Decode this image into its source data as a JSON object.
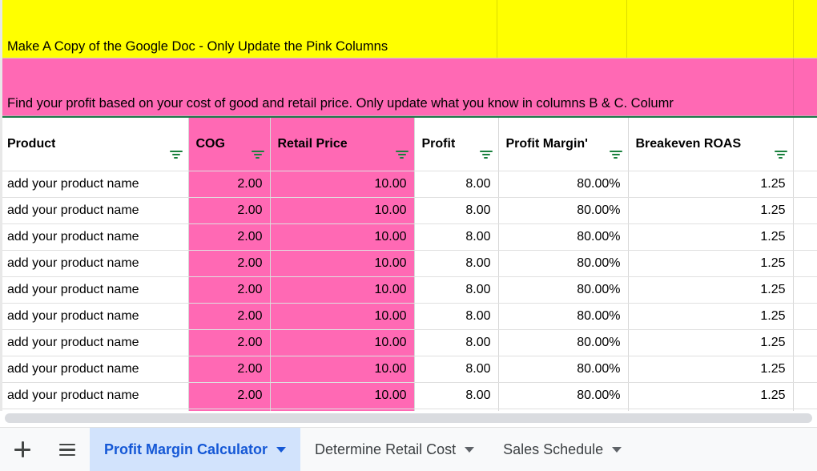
{
  "banners": {
    "yellow": {
      "text": "Make A Copy of the Google Doc - Only Update the Pink Columns",
      "bg": "#ffff00"
    },
    "pink": {
      "text": "Find your profit based on your cost of good and retail price. Only update what you know in columns B & C. Columr",
      "bg": "#ff69b4"
    }
  },
  "table": {
    "headers": [
      {
        "label": "Product",
        "pink": false
      },
      {
        "label": "COG",
        "pink": true
      },
      {
        "label": "Retail Price",
        "pink": true
      },
      {
        "label": "Profit",
        "pink": false
      },
      {
        "label": "Profit Margin'",
        "pink": false
      },
      {
        "label": "Breakeven ROAS",
        "pink": false
      }
    ],
    "filter_icon": "filter-funnel-icon",
    "rows": [
      {
        "product": "add your product name",
        "cog": "2.00",
        "retail": "10.00",
        "profit": "8.00",
        "margin": "80.00%",
        "roas": "1.25"
      },
      {
        "product": "add your product name",
        "cog": "2.00",
        "retail": "10.00",
        "profit": "8.00",
        "margin": "80.00%",
        "roas": "1.25"
      },
      {
        "product": "add your product name",
        "cog": "2.00",
        "retail": "10.00",
        "profit": "8.00",
        "margin": "80.00%",
        "roas": "1.25"
      },
      {
        "product": "add your product name",
        "cog": "2.00",
        "retail": "10.00",
        "profit": "8.00",
        "margin": "80.00%",
        "roas": "1.25"
      },
      {
        "product": "add your product name",
        "cog": "2.00",
        "retail": "10.00",
        "profit": "8.00",
        "margin": "80.00%",
        "roas": "1.25"
      },
      {
        "product": "add your product name",
        "cog": "2.00",
        "retail": "10.00",
        "profit": "8.00",
        "margin": "80.00%",
        "roas": "1.25"
      },
      {
        "product": "add your product name",
        "cog": "2.00",
        "retail": "10.00",
        "profit": "8.00",
        "margin": "80.00%",
        "roas": "1.25"
      },
      {
        "product": "add your product name",
        "cog": "2.00",
        "retail": "10.00",
        "profit": "8.00",
        "margin": "80.00%",
        "roas": "1.25"
      },
      {
        "product": "add your product name",
        "cog": "2.00",
        "retail": "10.00",
        "profit": "8.00",
        "margin": "80.00%",
        "roas": "1.25"
      }
    ]
  },
  "tabbar": {
    "add_icon": "plus-icon",
    "all_sheets_icon": "hamburger-icon",
    "tabs": [
      {
        "label": "Profit Margin Calculator",
        "active": true
      },
      {
        "label": "Determine Retail Cost",
        "active": false
      },
      {
        "label": "Sales Schedule",
        "active": false
      }
    ]
  },
  "colors": {
    "pink": "#ff69b4",
    "yellow": "#ffff00",
    "active_tab_bg": "#d2e3fc",
    "active_tab_text": "#1558d6",
    "filter_green": "#18803c"
  }
}
